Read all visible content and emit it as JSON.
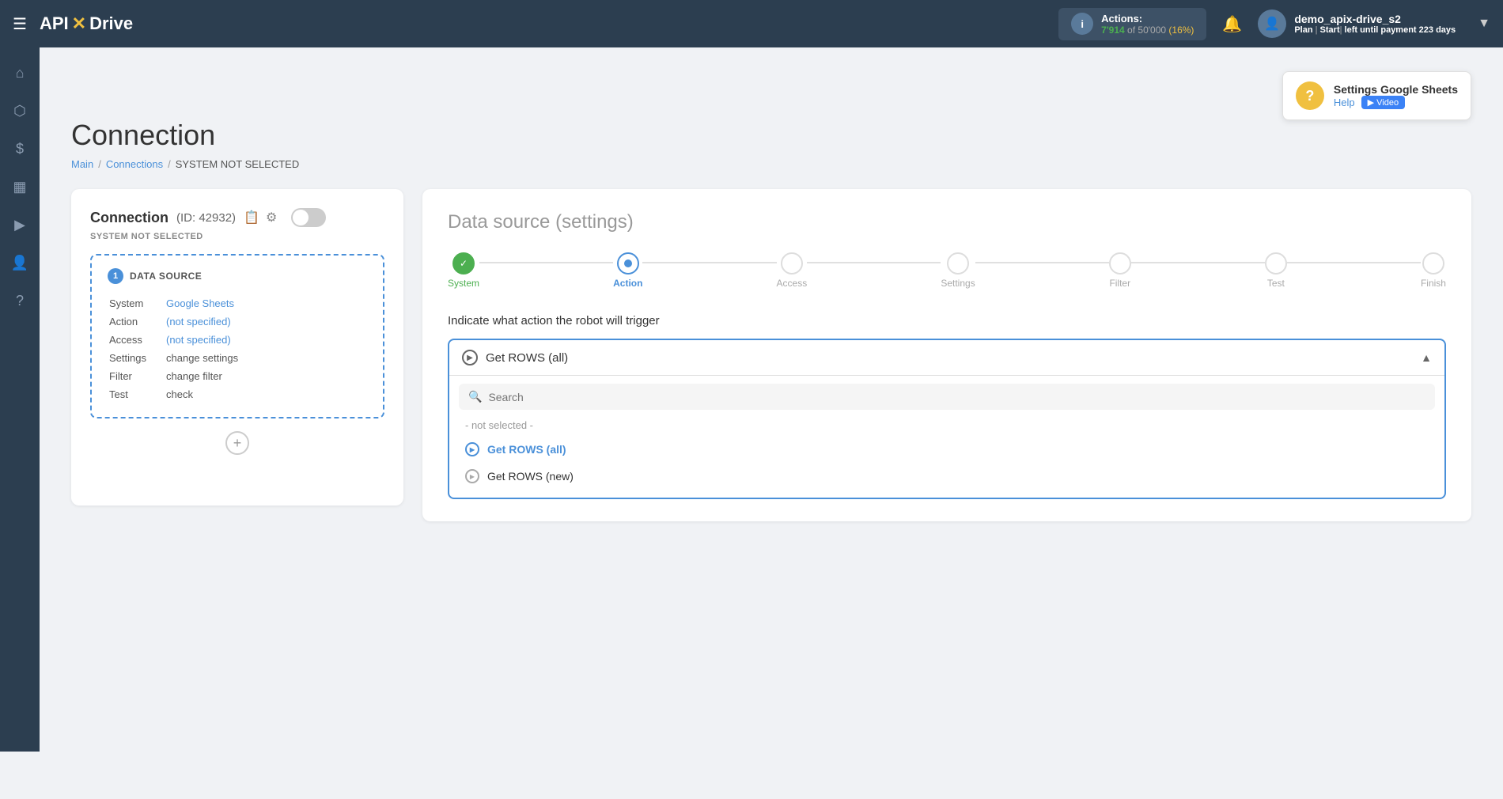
{
  "topnav": {
    "menu_icon": "☰",
    "logo_api": "API",
    "logo_x": "✕",
    "logo_drive": "Drive",
    "actions_label": "Actions:",
    "actions_used": "7'914",
    "actions_of": "of",
    "actions_total": "50'000",
    "actions_percent": "(16%)",
    "bell_icon": "🔔",
    "user_name": "demo_apix-drive_s2",
    "user_plan": "Plan",
    "user_start": "Start",
    "user_left": "left until payment",
    "user_days": "223",
    "user_days_suffix": "days",
    "chevron_down": "▼"
  },
  "sidebar": {
    "items": [
      {
        "icon": "⌂",
        "name": "home"
      },
      {
        "icon": "⬡",
        "name": "connections"
      },
      {
        "icon": "$",
        "name": "billing"
      },
      {
        "icon": "▦",
        "name": "templates"
      },
      {
        "icon": "▶",
        "name": "video"
      },
      {
        "icon": "👤",
        "name": "account"
      },
      {
        "icon": "?",
        "name": "help"
      }
    ]
  },
  "page": {
    "title": "Connection",
    "breadcrumb": {
      "main": "Main",
      "connections": "Connections",
      "current": "SYSTEM NOT SELECTED",
      "sep": "/"
    }
  },
  "help_box": {
    "title": "Settings Google Sheets",
    "help_label": "Help",
    "video_label": "▶ Video"
  },
  "connection_card": {
    "title": "Connection",
    "id_label": "(ID: 42932)",
    "system_not_selected": "SYSTEM NOT SELECTED",
    "datasource": {
      "number": "1",
      "title": "DATA SOURCE",
      "rows": [
        {
          "label": "System",
          "value": "Google Sheets",
          "type": "link"
        },
        {
          "label": "Action",
          "value": "(not specified)",
          "type": "link"
        },
        {
          "label": "Access",
          "value": "(not specified)",
          "type": "link"
        },
        {
          "label": "Settings",
          "value": "change settings",
          "type": "plain"
        },
        {
          "label": "Filter",
          "value": "change filter",
          "type": "plain"
        },
        {
          "label": "Test",
          "value": "check",
          "type": "plain"
        }
      ]
    },
    "add_icon": "+"
  },
  "datasource_settings": {
    "title": "Data source",
    "title_sub": "(settings)",
    "steps": [
      {
        "label": "System",
        "state": "completed"
      },
      {
        "label": "Action",
        "state": "active"
      },
      {
        "label": "Access",
        "state": "none"
      },
      {
        "label": "Settings",
        "state": "none"
      },
      {
        "label": "Filter",
        "state": "none"
      },
      {
        "label": "Test",
        "state": "none"
      },
      {
        "label": "Finish",
        "state": "none"
      }
    ],
    "action_prompt": "Indicate what action the robot will trigger",
    "dropdown": {
      "selected": "Get ROWS (all)",
      "search_placeholder": "Search",
      "not_selected": "- not selected -",
      "options": [
        {
          "label": "Get ROWS (all)",
          "selected": true
        },
        {
          "label": "Get ROWS (new)",
          "selected": false
        }
      ]
    }
  }
}
